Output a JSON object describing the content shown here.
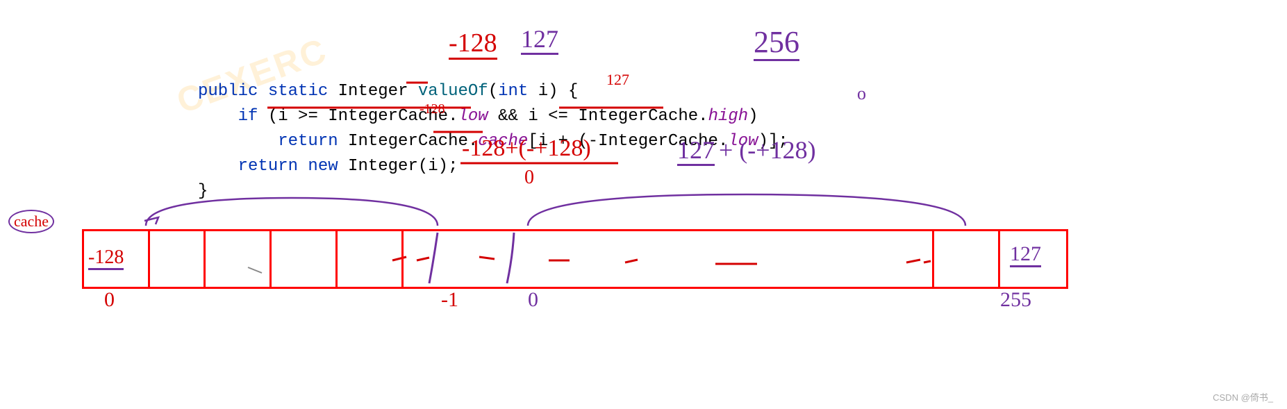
{
  "annotations": {
    "top_red": "-128",
    "top_purple": "127",
    "top_right": "256",
    "hand_127": "127",
    "hand_neg128": "-128",
    "expr_red": "-128+(-+128)",
    "expr_red_result": "0",
    "expr_purple_1": "127",
    "expr_purple_2": "+ (-+128)",
    "cache_label": "cache",
    "array_first": "-128",
    "array_last": "127",
    "idx_0": "0",
    "idx_neg1": "-1",
    "idx_0_mid": "0",
    "idx_255": "255",
    "stray_o": "o"
  },
  "code": {
    "l1_kw1": "public",
    "l1_kw2": "static",
    "l1_type": "Integer",
    "l1_method": "valueOf",
    "l1_paren_open": "(",
    "l1_kw3": "int",
    "l1_param": " i",
    "l1_close": ") {",
    "l2_kw": "if",
    "l2_open": " (",
    "l2_a": "i >= IntegerCache.",
    "l2_low": "low",
    "l2_mid": " && i <= Integer",
    "l2_cache": "Cache.",
    "l2_high": "high",
    "l2_close": ")",
    "l3_kw": "return",
    "l3_a": " IntegerCache.",
    "l3_cache": "cache",
    "l3_b": "[i + (-IntegerCache.",
    "l3_low": "low",
    "l3_c": ")];",
    "l4_kw": "return",
    "l4_new": " new",
    "l4_type": " Integer",
    "l4_rest": "(i);",
    "l5": "}"
  },
  "footer": "CSDN @倚书_"
}
